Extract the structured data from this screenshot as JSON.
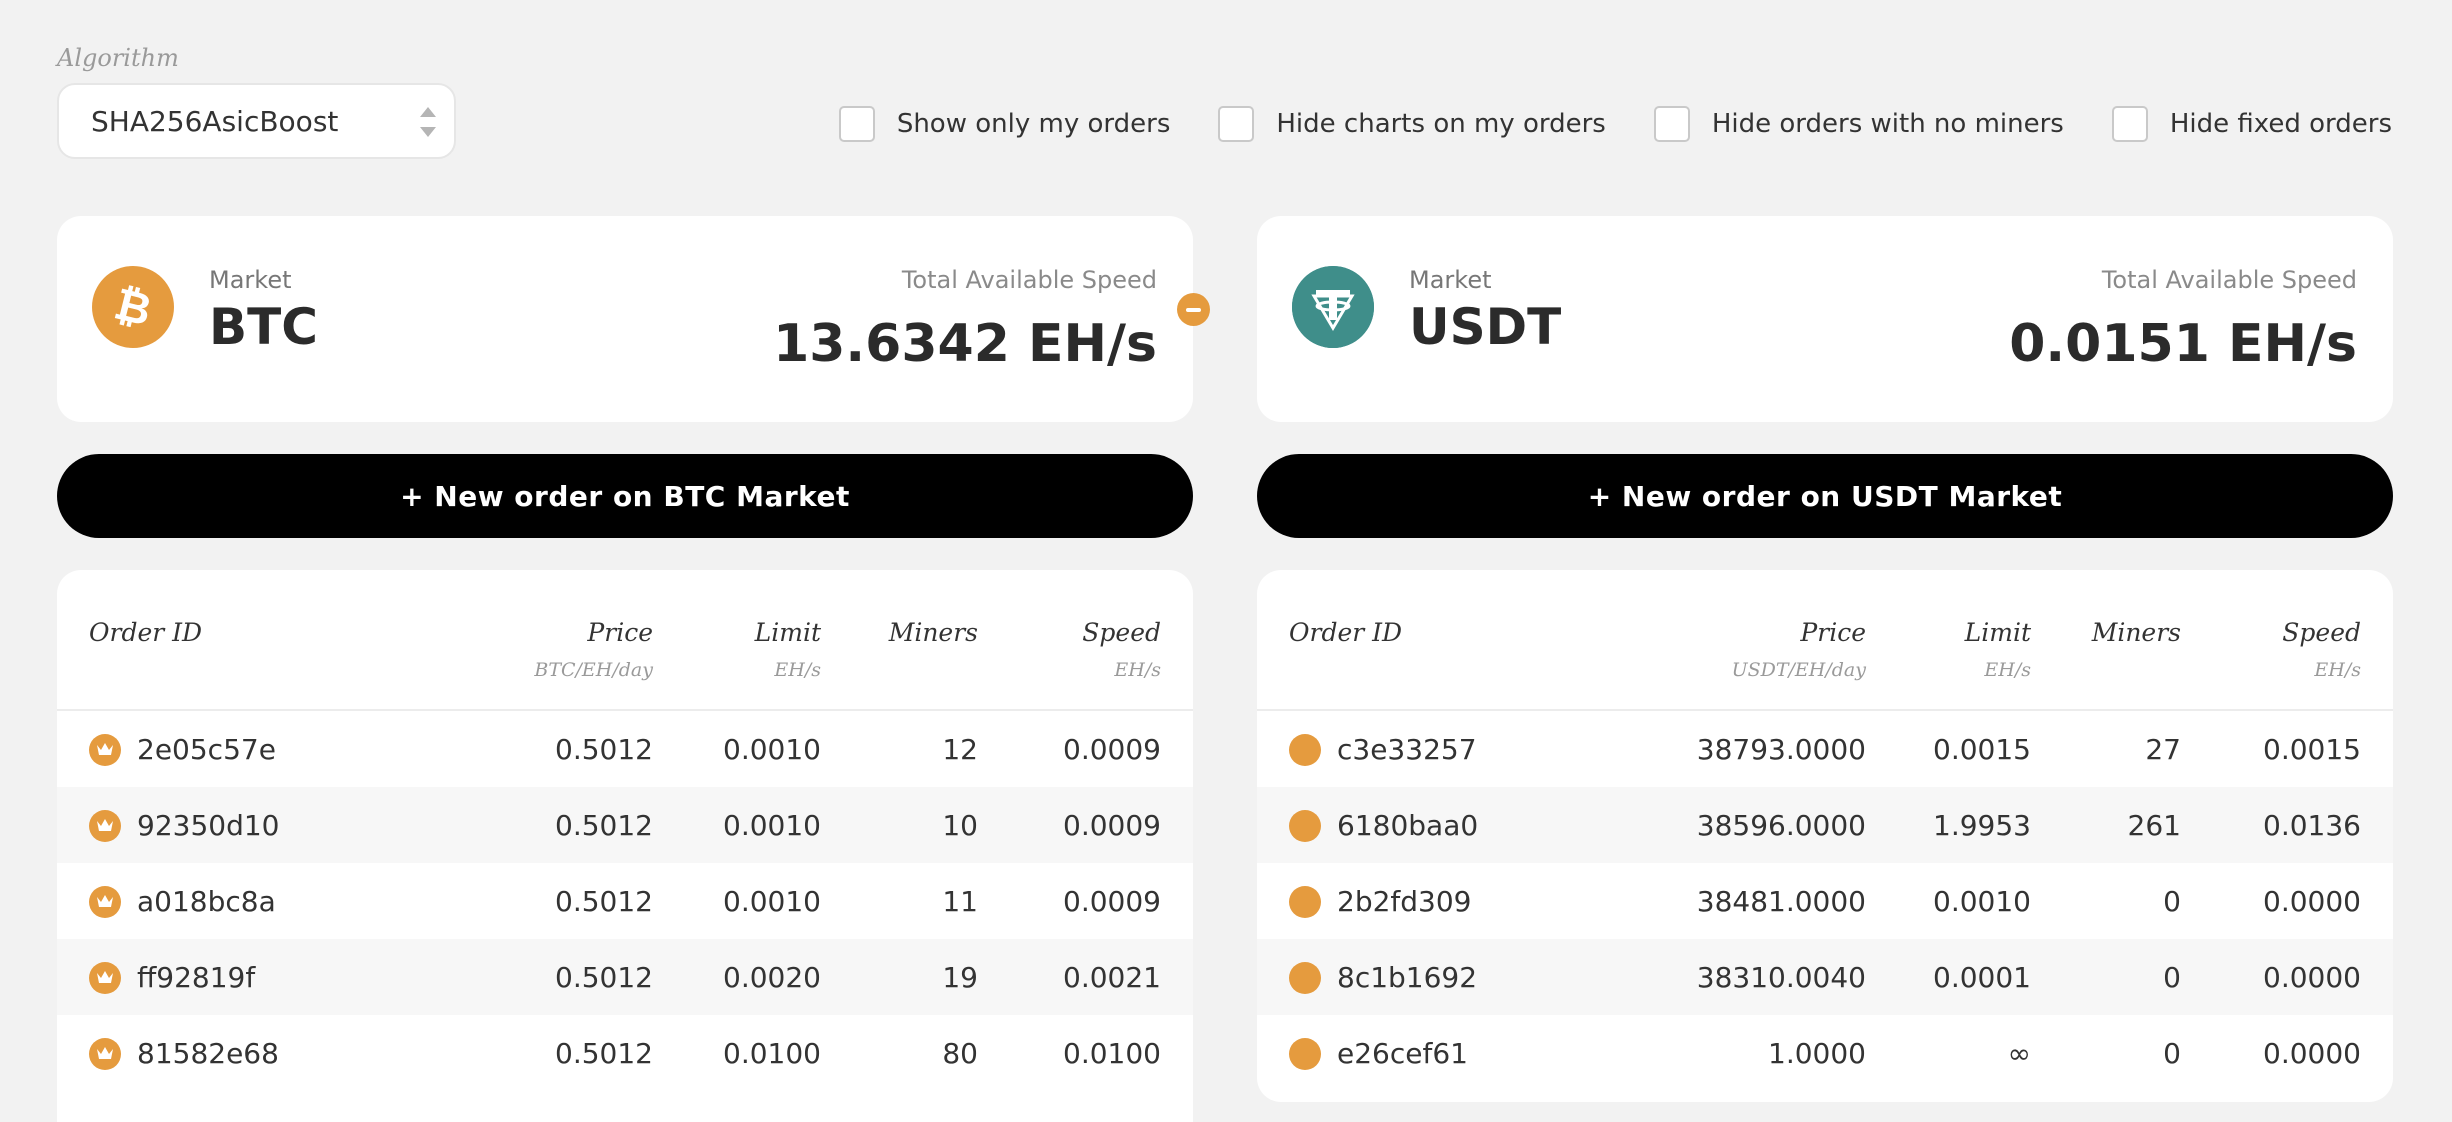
{
  "algorithm": {
    "label": "Algorithm",
    "selected": "SHA256AsicBoost"
  },
  "filters": [
    {
      "label": "Show only my orders",
      "checked": false
    },
    {
      "label": "Hide charts on my orders",
      "checked": false
    },
    {
      "label": "Hide orders with no miners",
      "checked": false
    },
    {
      "label": "Hide fixed orders",
      "checked": false
    }
  ],
  "markets": {
    "btc": {
      "market_label": "Market",
      "name": "BTC",
      "speed_label": "Total Available Speed",
      "speed": "13.6342 EH/s",
      "new_order": "+ New order on BTC Market",
      "icon": "bitcoin-icon",
      "color": "#e59b3e",
      "columns": {
        "order_id": "Order ID",
        "price": "Price",
        "price_unit": "BTC/EH/day",
        "limit": "Limit",
        "limit_unit": "EH/s",
        "miners": "Miners",
        "speed": "Speed",
        "speed_unit": "EH/s"
      },
      "rows": [
        {
          "id": "2e05c57e",
          "price": "0.5012",
          "limit": "0.0010",
          "miners": "12",
          "speed": "0.0009"
        },
        {
          "id": "92350d10",
          "price": "0.5012",
          "limit": "0.0010",
          "miners": "10",
          "speed": "0.0009"
        },
        {
          "id": "a018bc8a",
          "price": "0.5012",
          "limit": "0.0010",
          "miners": "11",
          "speed": "0.0009"
        },
        {
          "id": "ff92819f",
          "price": "0.5012",
          "limit": "0.0020",
          "miners": "19",
          "speed": "0.0021"
        },
        {
          "id": "81582e68",
          "price": "0.5012",
          "limit": "0.0100",
          "miners": "80",
          "speed": "0.0100"
        }
      ]
    },
    "usdt": {
      "market_label": "Market",
      "name": "USDT",
      "speed_label": "Total Available Speed",
      "speed": "0.0151 EH/s",
      "new_order": "+ New order on USDT Market",
      "icon": "tether-icon",
      "color": "#3f8e8a",
      "columns": {
        "order_id": "Order ID",
        "price": "Price",
        "price_unit": "USDT/EH/day",
        "limit": "Limit",
        "limit_unit": "EH/s",
        "miners": "Miners",
        "speed": "Speed",
        "speed_unit": "EH/s"
      },
      "rows": [
        {
          "id": "c3e33257",
          "price": "38793.0000",
          "limit": "0.0015",
          "miners": "27",
          "speed": "0.0015"
        },
        {
          "id": "6180baa0",
          "price": "38596.0000",
          "limit": "1.9953",
          "miners": "261",
          "speed": "0.0136"
        },
        {
          "id": "2b2fd309",
          "price": "38481.0000",
          "limit": "0.0010",
          "miners": "0",
          "speed": "0.0000"
        },
        {
          "id": "8c1b1692",
          "price": "38310.0040",
          "limit": "0.0001",
          "miners": "0",
          "speed": "0.0000"
        },
        {
          "id": "e26cef61",
          "price": "1.0000",
          "limit": "∞",
          "miners": "0",
          "speed": "0.0000"
        }
      ]
    }
  }
}
